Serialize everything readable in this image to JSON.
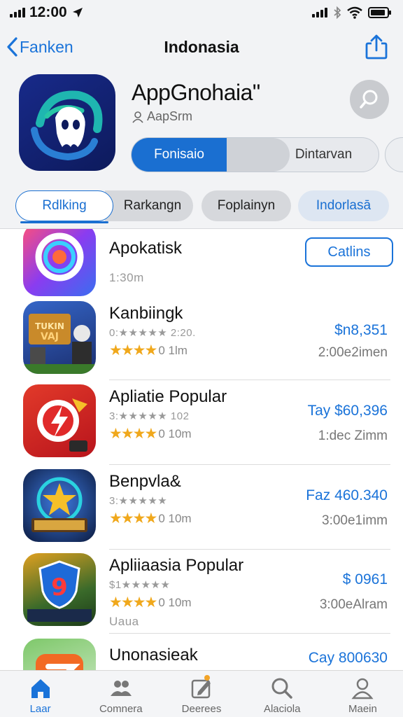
{
  "status_bar": {
    "time": "12:00"
  },
  "nav": {
    "back_label": "Fanken",
    "title": "Indonasia"
  },
  "hero": {
    "app_name": "AppGnohaia\"",
    "developer": "AapSrm",
    "segment_active": "Fonisaio",
    "segment_other": "Dintarvan"
  },
  "chips": [
    "Rdlking",
    "Rarkangn",
    "Foplainyn",
    "Indorlasā"
  ],
  "list": {
    "rows": [
      {
        "name": "Apokatisk",
        "sub": "1:30m",
        "action": "Catlins",
        "icon": "ring-icon"
      },
      {
        "name": "Kanbiingk",
        "sub": "0:★★★★★  2:20.",
        "stars": "★★★★",
        "rating": "0 1lm",
        "price": "$n8,351",
        "meta": "2:00e2imen",
        "icon": "game-kanban-icon"
      },
      {
        "name": "Apliatie Popular",
        "sub": "3:★★★★★ 102",
        "stars": "★★★★",
        "rating": "0 10m",
        "price": "Tay $60,396",
        "meta": "1:dec Zimm",
        "icon": "lightning-icon"
      },
      {
        "name": "Benpvla&",
        "sub": "3:★★★★★",
        "stars": "★★★★",
        "rating": "0 10m",
        "price": "Faz 460.340",
        "meta": "3:00e1imm",
        "icon": "star-badge-icon"
      },
      {
        "name": "Apliiaasia Popular",
        "sub": "$1★★★★★",
        "stars": "★★★★",
        "rating": "0 10m",
        "extra": "Uaua",
        "price": "$ 0961",
        "meta": "3:00eAlram",
        "icon": "shield-9-icon"
      },
      {
        "name": "Unonasieak",
        "price": "Cay 800630",
        "icon": "orange-arrow-icon"
      }
    ]
  },
  "tabbar": {
    "tabs": [
      {
        "label": "Laar",
        "icon": "home-icon"
      },
      {
        "label": "Comnera",
        "icon": "people-icon"
      },
      {
        "label": "Deerees",
        "icon": "edit-icon"
      },
      {
        "label": "Alaciola",
        "icon": "search-icon"
      },
      {
        "label": "Maein",
        "icon": "profile-icon"
      }
    ]
  },
  "colors": {
    "accent": "#1a73d9",
    "star": "#f0a81c",
    "header_bg": "#f2f3f5"
  }
}
